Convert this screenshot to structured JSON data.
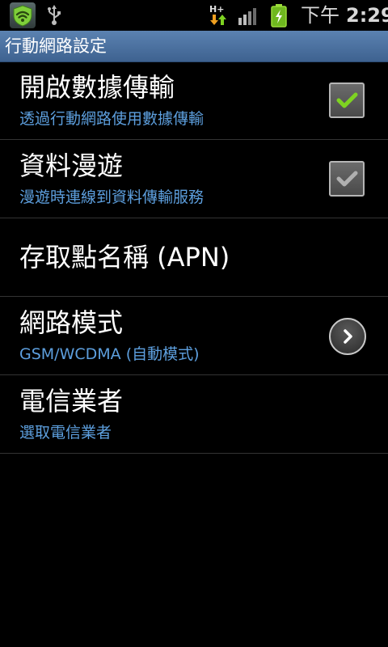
{
  "status_bar": {
    "app_icon": "shield-wifi-icon",
    "usb_icon": "usb-icon",
    "network_type": "H+",
    "signal_icon": "signal-bars-icon",
    "battery_icon": "battery-charging-icon",
    "time_ampm": "下午",
    "time_clock": "2:29"
  },
  "title_bar": {
    "title": "行動網路設定"
  },
  "settings": {
    "data_enabled": {
      "title": "開啟數據傳輸",
      "summary": "透過行動網路使用數據傳輸",
      "checked": true,
      "enabled": true
    },
    "data_roaming": {
      "title": "資料漫遊",
      "summary": "漫遊時連線到資料傳輸服務",
      "checked": true,
      "enabled": false
    },
    "apn": {
      "title": "存取點名稱 (APN)"
    },
    "network_mode": {
      "title": "網路模式",
      "summary": "GSM/WCDMA (自動模式)",
      "icon": "chevron-right-icon"
    },
    "operators": {
      "title": "電信業者",
      "summary": "選取電信業者"
    }
  },
  "colors": {
    "title_bar": "#4a70a0",
    "summary_text": "#5d9fde",
    "check_active": "#7ed321",
    "check_disabled": "#b0b0b0"
  }
}
